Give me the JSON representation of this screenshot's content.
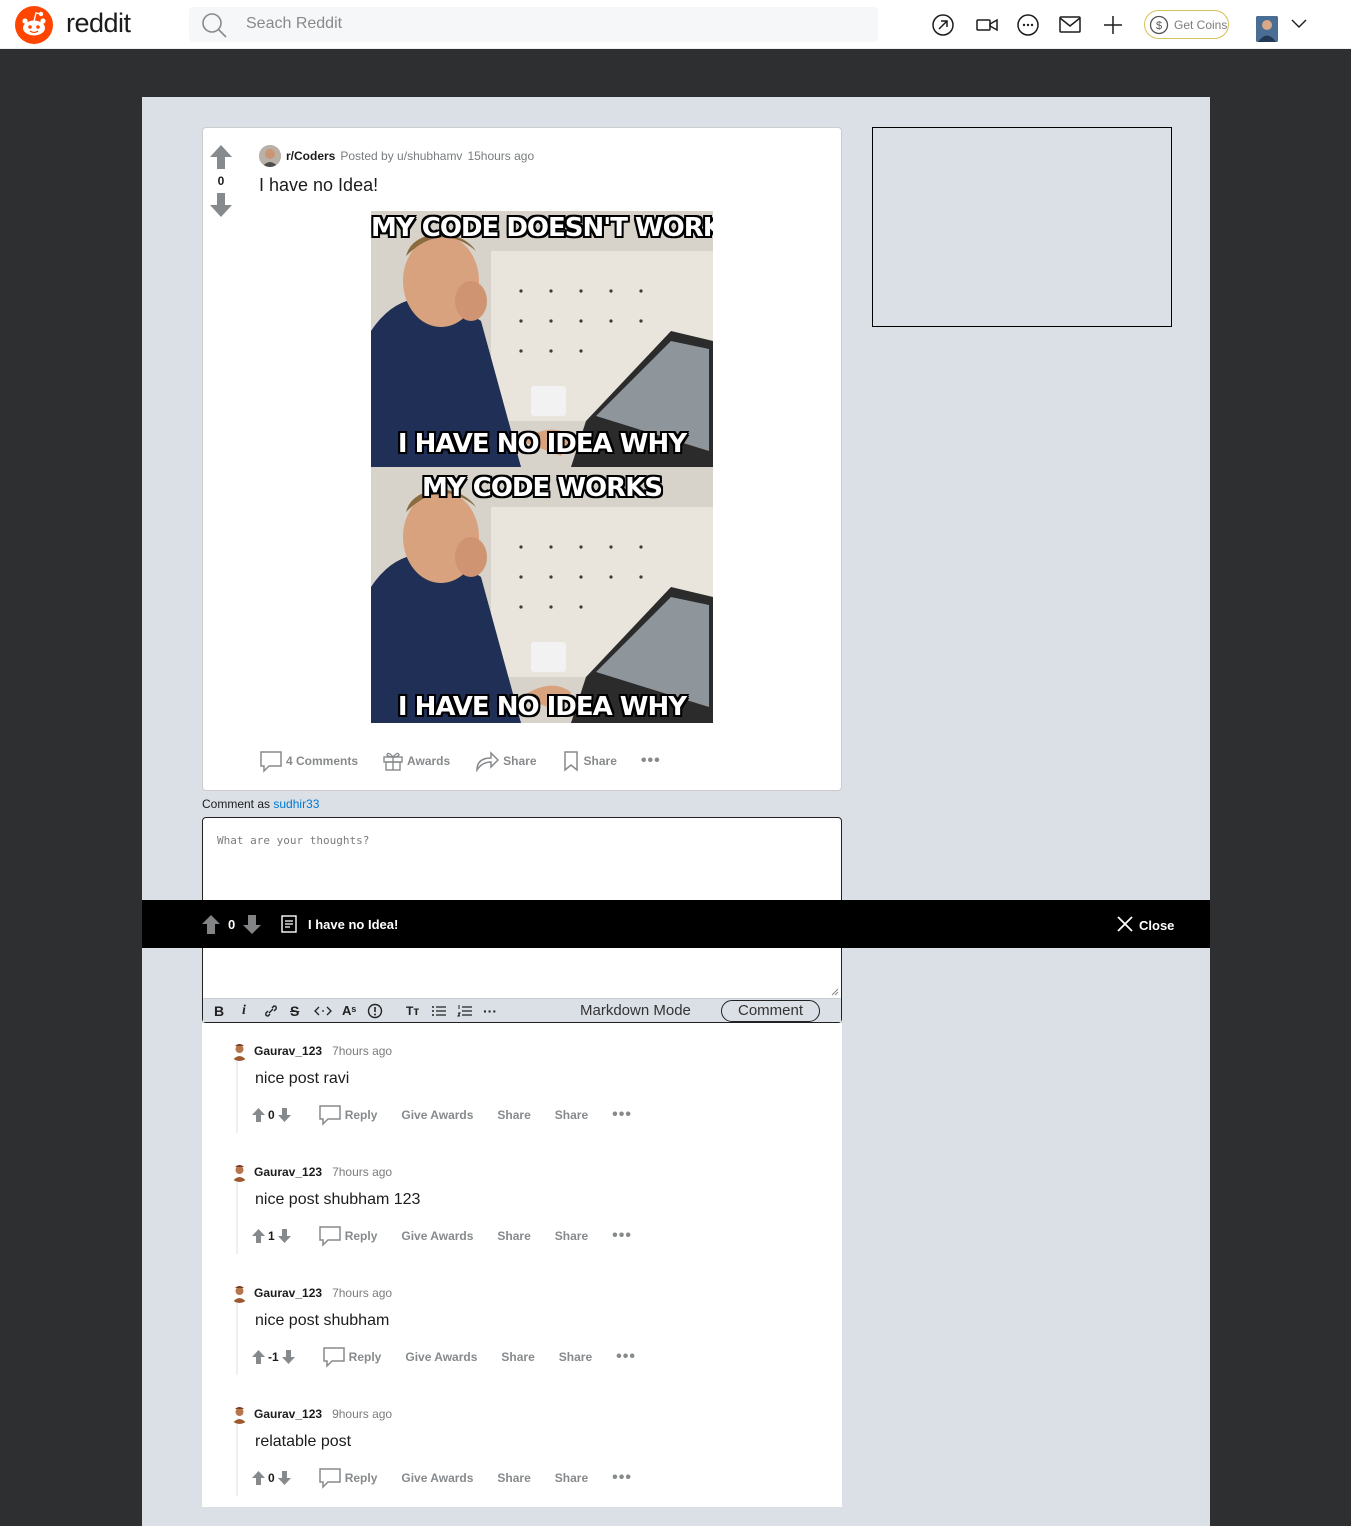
{
  "header": {
    "logo_text": "reddit",
    "search_placeholder": "Seach Reddit",
    "get_coins_label": "Get Coins"
  },
  "post": {
    "vote_count": "0",
    "subreddit": "r/Coders",
    "posted_by": "Posted by u/shubhamv",
    "time": "15hours ago",
    "title": "I have no Idea!",
    "meme_lines": {
      "top_1": "MY CODE DOESN'T WORK",
      "bottom_1": "I HAVE NO IDEA WHY",
      "top_2": "MY CODE WORKS",
      "bottom_2": "I HAVE NO IDEA WHY"
    },
    "actions": {
      "comments": "4 Comments",
      "awards": "Awards",
      "share": "Share",
      "save": "Share",
      "more": "•••"
    }
  },
  "comment_box": {
    "comment_as_prefix": "Comment as",
    "username": "sudhir33",
    "placeholder": "What are your thoughts?",
    "markdown_mode": "Markdown Mode",
    "comment_button": "Comment"
  },
  "sticky_bar": {
    "vote_count": "0",
    "title": "I have no Idea!",
    "close_label": "Close"
  },
  "comments": [
    {
      "user": "Gaurav_123",
      "time": "7hours ago",
      "body": "nice post ravi",
      "votes": "0",
      "reply": "Reply",
      "give_awards": "Give Awards",
      "share": "Share",
      "save": "Share",
      "more": "•••"
    },
    {
      "user": "Gaurav_123",
      "time": "7hours ago",
      "body": "nice post shubham 123",
      "votes": "1",
      "reply": "Reply",
      "give_awards": "Give Awards",
      "share": "Share",
      "save": "Share",
      "more": "•••"
    },
    {
      "user": "Gaurav_123",
      "time": "7hours ago",
      "body": "nice post shubham",
      "votes": "-1",
      "reply": "Reply",
      "give_awards": "Give Awards",
      "share": "Share",
      "save": "Share",
      "more": "•••"
    },
    {
      "user": "Gaurav_123",
      "time": "9hours ago",
      "body": "relatable post",
      "votes": "0",
      "reply": "Reply",
      "give_awards": "Give Awards",
      "share": "Share",
      "save": "Share",
      "more": "•••"
    }
  ],
  "colors": {
    "brand": "#ff4500",
    "link": "#0079d3",
    "overlay_bg": "#dae0e6",
    "page_bg": "#2e2f30"
  }
}
